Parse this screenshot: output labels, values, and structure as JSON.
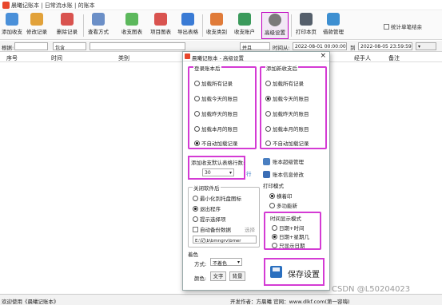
{
  "window": {
    "title": "晨曦记账本 | 日常流水账 | 的账本"
  },
  "toolbar": {
    "items": [
      {
        "label": "添加收支",
        "color": "#4a90d9"
      },
      {
        "label": "修改记录",
        "color": "#e2a23a"
      },
      {
        "label": "删除记录",
        "color": "#d9534f"
      },
      {
        "label": "查看方式",
        "color": "#6b8fc7"
      },
      {
        "label": "收支图表",
        "color": "#5cb85c"
      },
      {
        "label": "项目图表",
        "color": "#d9534f"
      },
      {
        "label": "导出表格",
        "color": "#3a7bd5"
      },
      {
        "label": "收支类别",
        "color": "#e07b39"
      },
      {
        "label": "收支账户",
        "color": "#3b9a5b"
      },
      {
        "label": "高级设置",
        "color": "#7a7a7a"
      },
      {
        "label": "打印本页",
        "color": "#555f6b"
      },
      {
        "label": "借款管理",
        "color": "#3d8fd1"
      }
    ],
    "stat_label": "统计单笔结余"
  },
  "filter": {
    "label": "根据:",
    "sel1": "包含",
    "sel2": "并且",
    "time_label": "时间从:",
    "time_from": "2022-08-01 00:00:00",
    "to_label": "到",
    "time_to": "2022-08-05 23:59:59",
    "search_label": "搜索"
  },
  "table": {
    "headers": [
      "序号",
      "时间",
      "类别",
      "经手人",
      "备注"
    ]
  },
  "statusbar": {
    "left": "欢迎使用《晨曦记账本》",
    "right": "开发作者：方晨曦  官网：www.dlkf.com(第一容嗨)"
  },
  "dialog": {
    "title": "晨曦记账本 - 高级设置",
    "login": {
      "title": "登录账本后",
      "options": [
        "加载所有记录",
        "加载今天的账目",
        "加载昨天的账目",
        "加载本月的账目",
        "不自动加载记录"
      ],
      "selected": 4
    },
    "add": {
      "title": "添加新收支后",
      "options": [
        "加载所有记录",
        "加载今天的账目",
        "加载昨天的账目",
        "加载本月的账目",
        "不自动加载记录"
      ],
      "selected": 1
    },
    "rows": {
      "label": "添加收支默认表格行数:",
      "value": "30",
      "unit": "行"
    },
    "links": [
      "账本超级管理",
      "账本信息修改"
    ],
    "close": {
      "title": "关闭软件后",
      "options": [
        "最小化到托盘图标",
        "退出程序",
        "提示选择项"
      ],
      "selected": 1,
      "backup_label": "自动备份数据",
      "backup_btn": "选择",
      "path": "E:\\记\\b\\bmngrv\\bmer"
    },
    "print": {
      "title": "打印模式",
      "options": [
        "横着印",
        "多功能新"
      ],
      "selected": 0
    },
    "timefmt": {
      "title": "时间显示模式",
      "options": [
        "日期+时间",
        "日期+星期几",
        "只显示日期"
      ],
      "selected": 1
    },
    "color": {
      "title": "着色",
      "mode_label": "方式:",
      "mode_value": "不着色",
      "color_label": "颜色:",
      "text_btn": "文字",
      "bg_btn": "背景"
    },
    "save_label": "保存设置"
  },
  "watermark": "CSDN @L50204023"
}
